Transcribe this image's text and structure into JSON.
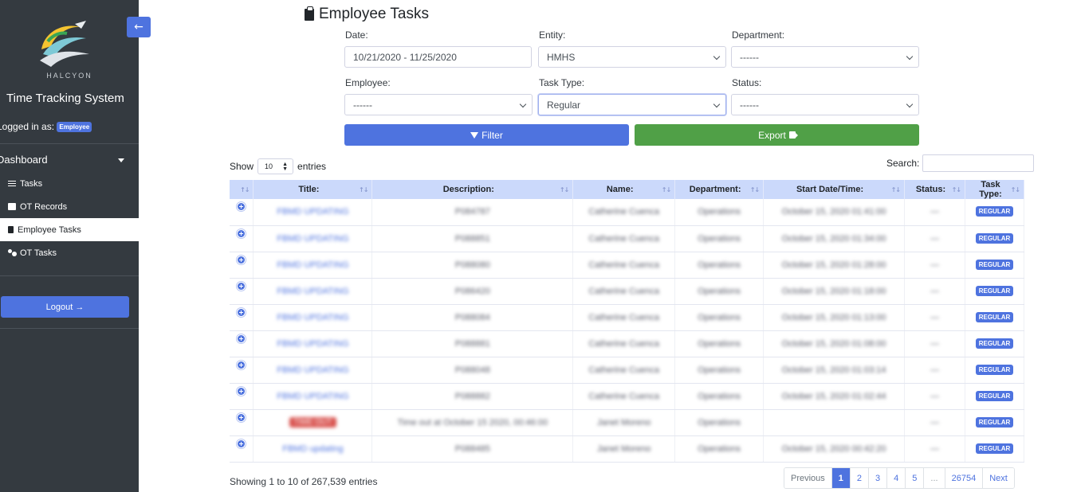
{
  "sidebar": {
    "logo_text": "HALCYON",
    "app_title": "Time Tracking System",
    "logged_in_label": "Logged in as:",
    "role_badge": "Employee",
    "dashboard_label": "Dashboard",
    "items": [
      {
        "label": "Tasks",
        "icon": "list-icon"
      },
      {
        "label": "OT Records",
        "icon": "records-icon"
      },
      {
        "label": "Employee Tasks",
        "icon": "clipboard-icon",
        "active": true
      },
      {
        "label": "OT Tasks",
        "icon": "users-icon"
      }
    ],
    "logout_label": "Logout"
  },
  "header": {
    "title": "Employee Tasks"
  },
  "filters": {
    "date_label": "Date:",
    "date_value": "10/21/2020 - 11/25/2020",
    "entity_label": "Entity:",
    "entity_value": "HMHS",
    "department_label": "Department:",
    "department_value": "------",
    "employee_label": "Employee:",
    "employee_value": "------",
    "task_type_label": "Task Type:",
    "task_type_value": "Regular",
    "status_label": "Status:",
    "status_value": "------",
    "filter_label": "Filter",
    "export_label": "Export"
  },
  "table_controls": {
    "show_label": "Show",
    "entries_label": "entries",
    "page_length": "10",
    "search_label": "Search:"
  },
  "table": {
    "columns": [
      "",
      "Title:",
      "Description:",
      "Name:",
      "Department:",
      "Start Date/Time:",
      "Status:",
      "Task Type:"
    ],
    "rows": [
      {
        "title": "FBMD UPDATING",
        "desc": "P084787",
        "name": "Catherine Cuenca",
        "dept": "Operations",
        "start": "October 15, 2020 01:41:00",
        "status": "—",
        "type": "REGULAR"
      },
      {
        "title": "FBMD UPDATING",
        "desc": "P088851",
        "name": "Catherine Cuenca",
        "dept": "Operations",
        "start": "October 15, 2020 01:34:00",
        "status": "—",
        "type": "REGULAR"
      },
      {
        "title": "FBMD UPDATING",
        "desc": "P088080",
        "name": "Catherine Cuenca",
        "dept": "Operations",
        "start": "October 15, 2020 01:28:00",
        "status": "—",
        "type": "REGULAR"
      },
      {
        "title": "FBMD UPDATING",
        "desc": "P086420",
        "name": "Catherine Cuenca",
        "dept": "Operations",
        "start": "October 15, 2020 01:18:00",
        "status": "—",
        "type": "REGULAR"
      },
      {
        "title": "FBMD UPDATING",
        "desc": "P088084",
        "name": "Catherine Cuenca",
        "dept": "Operations",
        "start": "October 15, 2020 01:13:00",
        "status": "—",
        "type": "REGULAR"
      },
      {
        "title": "FBMD UPDATING",
        "desc": "P088881",
        "name": "Catherine Cuenca",
        "dept": "Operations",
        "start": "October 15, 2020 01:08:00",
        "status": "—",
        "type": "REGULAR"
      },
      {
        "title": "FBMD UPDATING",
        "desc": "P088048",
        "name": "Catherine Cuenca",
        "dept": "Operations",
        "start": "October 15, 2020 01:03:14",
        "status": "—",
        "type": "REGULAR"
      },
      {
        "title": "FBMD UPDATING",
        "desc": "P088882",
        "name": "Catherine Cuenca",
        "dept": "Operations",
        "start": "October 15, 2020 01:02:44",
        "status": "—",
        "type": "REGULAR"
      },
      {
        "title": "TIME OUT",
        "desc": "Time out at October 15 2020, 00:46:00",
        "name": "Janet Moreno",
        "dept": "Operations",
        "start": "",
        "status": "—",
        "type": "REGULAR",
        "red": true
      },
      {
        "title": "FBMD updating",
        "desc": "P088485",
        "name": "Janet Moreno",
        "dept": "Operations",
        "start": "October 15, 2020 00:42:20",
        "status": "—",
        "type": "REGULAR"
      }
    ]
  },
  "footer": {
    "info": "Showing 1 to 10 of 267,539 entries",
    "pagination": [
      "Previous",
      "1",
      "2",
      "3",
      "4",
      "5",
      "...",
      "26754",
      "Next"
    ]
  },
  "colors": {
    "primary": "#4e73df",
    "success": "#50a047",
    "sidebar": "#343a40",
    "header_row": "#cbd9fb"
  }
}
